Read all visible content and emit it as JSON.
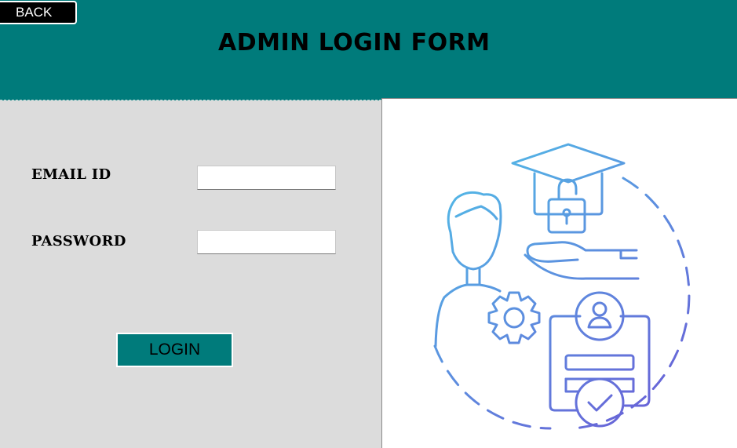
{
  "header": {
    "title": "ADMIN LOGIN FORM",
    "back_label": "BACK",
    "color": "#007b7b"
  },
  "form": {
    "email_label": "EMAIL ID",
    "email_value": "",
    "password_label": "PASSWORD",
    "password_value": "",
    "login_label": "LOGIN"
  },
  "illustration": {
    "icon": "admin-access-illustration",
    "colors": [
      "#4fc3e8",
      "#6a5bd6"
    ]
  }
}
